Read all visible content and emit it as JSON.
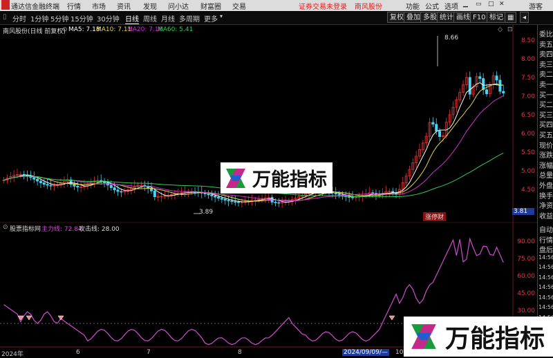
{
  "window": {
    "app_title": "通达信金融终端",
    "menu": [
      "行情",
      "市场",
      "资讯",
      "发现",
      "问小达",
      "财富圈",
      "交易"
    ],
    "notice": "证券交易未登录",
    "notice_stock": "南风股份",
    "right_menu": [
      "功能",
      "公式",
      "选项"
    ],
    "user": "游客"
  },
  "periods": [
    "分时",
    "1分钟",
    "5分钟",
    "15分钟",
    "30分钟",
    "日线",
    "周线",
    "月线",
    "多周期",
    "更多"
  ],
  "active_period": "日线",
  "toolbar_buttons": [
    "复权",
    "叠加",
    "多股",
    "统计",
    "画线",
    "F10",
    "标记"
  ],
  "main_panel": {
    "stock_label": "南风股份(日线 前复权)",
    "ma5_label": "MA5: 7.18",
    "ma10_label": "MA10: 7.11",
    "ma20_label": "MA20: 7.16",
    "ma60_label": "MA60: 5.41",
    "high_annotation": "8.66",
    "low_annotation": "3.89",
    "tag_label": "涨停财",
    "current_price": "3.81",
    "y_ticks": [
      "8.50",
      "8.00",
      "7.50",
      "7.00",
      "6.50",
      "6.00",
      "5.50",
      "5.00",
      "4.50"
    ]
  },
  "sub_panel": {
    "title": "股票指标网",
    "main_label": "主力线: 72.84",
    "attack_label": "攻击线: 28.00",
    "y_ticks": [
      "90.00",
      "75.00",
      "60.00",
      "45.00",
      "30.00"
    ]
  },
  "x_axis": {
    "labels": [
      "2024年",
      "6",
      "7",
      "8",
      "2024/09/09/—",
      "10"
    ]
  },
  "side_panel": {
    "top": [
      "委比",
      "卖五",
      "卖四",
      "卖三",
      "卖二",
      "卖一",
      "买一",
      "买二",
      "买三",
      "买四",
      "买五",
      "现价",
      "涨跌",
      "涨幅",
      "总量",
      "外盘",
      "换手",
      "净资",
      "收益"
    ],
    "bottom": [
      "自动",
      "行情",
      "盘后",
      "14:56",
      "14:56",
      "14:56",
      "14:56",
      "14:56",
      "14:56",
      "14:56"
    ]
  },
  "watermark": {
    "text": "万能指标"
  },
  "colors": {
    "up": "#e53333",
    "down": "#4ad2f2",
    "ma5": "#ffffff",
    "ma10": "#e6d84a",
    "ma20": "#cc33cc",
    "ma60": "#33cc55",
    "indicator": "#d24dd2",
    "axis": "#e34040"
  }
}
